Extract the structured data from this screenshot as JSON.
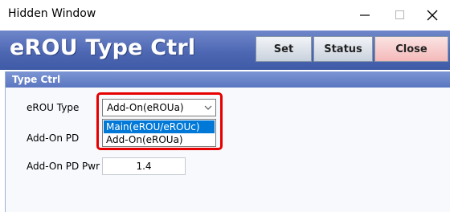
{
  "window": {
    "title": "Hidden Window"
  },
  "header": {
    "title": "eROU Type Ctrl",
    "buttons": {
      "set": "Set",
      "status": "Status",
      "close": "Close"
    }
  },
  "panel": {
    "title": "Type Ctrl"
  },
  "form": {
    "erou_type": {
      "label": "eROU Type",
      "selected": "Add-On(eROUa)",
      "options": [
        "Main(eROU/eROUc)",
        "Add-On(eROUa)"
      ]
    },
    "addon_pd": {
      "label": "Add-On PD"
    },
    "addon_pd_pwr": {
      "label": "Add-On PD Pwr",
      "value": "1.4"
    }
  },
  "colors": {
    "header_bg": "#4d67b3",
    "highlight": "#e60000",
    "selected_option": "#0078d7"
  }
}
